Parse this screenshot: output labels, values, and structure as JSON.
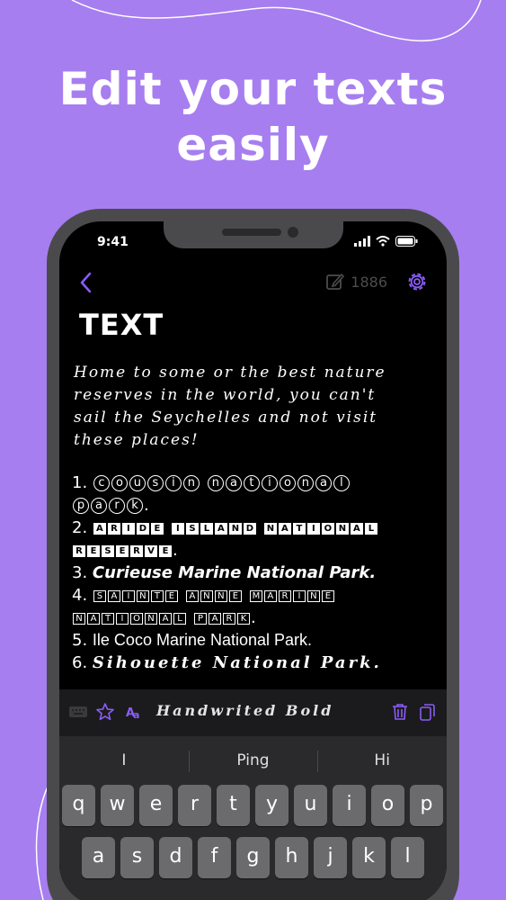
{
  "headline": {
    "line1": "Edit your texts",
    "line2": "easily"
  },
  "status_bar": {
    "time": "9:41"
  },
  "header": {
    "char_count": "1886"
  },
  "document": {
    "title": "TEXT",
    "intro_lines": [
      "Home to some or the best nature",
      "reserves in the world, you can't",
      "sail the Seychelles and not visit",
      "these places!"
    ],
    "items": [
      {
        "num": "1.",
        "line1": "cousin national",
        "line2": "park."
      },
      {
        "num": "2.",
        "line1": "ARIDE ISLAND NATIONAL",
        "line2": "RESERVE."
      },
      {
        "num": "3.",
        "text": "Curieuse Marine National Park."
      },
      {
        "num": "4.",
        "line1": "SAINTE ANNE MARINE",
        "line2": "NATIONAL PARK."
      },
      {
        "num": "5.",
        "text": "Ile Coco Marine National Park."
      },
      {
        "num": "6.",
        "text": "Sihouette National Park."
      }
    ]
  },
  "toolbar": {
    "font_name": "Handwrited Bold",
    "icons": [
      "keyboard-icon",
      "star-icon",
      "fonts-icon",
      "trash-icon",
      "copy-icon"
    ]
  },
  "keyboard": {
    "suggestions": [
      "I",
      "Ping",
      "Hi"
    ],
    "row1": [
      "q",
      "w",
      "e",
      "r",
      "t",
      "y",
      "u",
      "i",
      "o",
      "p"
    ],
    "row2": [
      "a",
      "s",
      "d",
      "f",
      "g",
      "h",
      "j",
      "k",
      "l"
    ]
  },
  "colors": {
    "background": "#a77ef0",
    "accent": "#8b5cf6",
    "screen": "#000000"
  }
}
